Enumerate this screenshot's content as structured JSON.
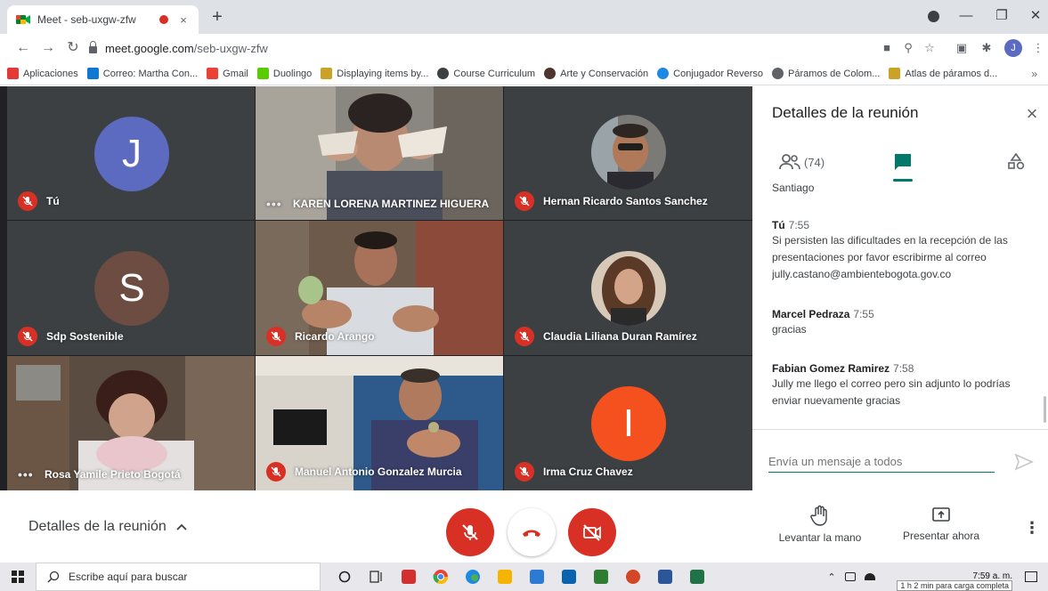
{
  "browser": {
    "tab_title": "Meet - seb-uxgw-zfw",
    "tab_close": "×",
    "new_tab": "+",
    "url_host": "meet.google.com",
    "url_path": "/seb-uxgw-zfw",
    "profile_initial": "J"
  },
  "bookmarks": [
    {
      "label": "Aplicaciones",
      "color": "#e53935"
    },
    {
      "label": "Correo: Martha Con...",
      "color": "#0f78d4"
    },
    {
      "label": "Gmail",
      "color": "#ea4335"
    },
    {
      "label": "Duolingo",
      "color": "#58cc02"
    },
    {
      "label": "Displaying items by...",
      "color": "#c9a227"
    },
    {
      "label": "Course Curriculum",
      "color": "#3c4043"
    },
    {
      "label": "Arte y Conservación",
      "color": "#4e342e"
    },
    {
      "label": "Conjugador Reverso",
      "color": "#1e88e5"
    },
    {
      "label": "Páramos de Colom...",
      "color": "#5f6368"
    },
    {
      "label": "Atlas de páramos d...",
      "color": "#c9a227"
    }
  ],
  "bookmarks_more": "»",
  "participants": [
    {
      "name": "Tú",
      "status": "muted"
    },
    {
      "name": "KAREN LORENA MARTINEZ HIGUERA",
      "status": "speaking"
    },
    {
      "name": "Hernan Ricardo Santos Sanchez",
      "status": "muted"
    },
    {
      "name": "Sdp Sostenible",
      "status": "muted"
    },
    {
      "name": "Ricardo Arango",
      "status": "muted"
    },
    {
      "name": "Claudia Liliana Duran Ramírez",
      "status": "muted"
    },
    {
      "name": "Rosa Yamile Prieto Bogotá",
      "status": "speaking"
    },
    {
      "name": "Manuel Antonio Gonzalez Murcia",
      "status": "muted"
    },
    {
      "name": "Irma Cruz Chavez",
      "status": "muted"
    }
  ],
  "avatars": {
    "tu": {
      "letter": "J",
      "color": "#5c6bc0"
    },
    "sdp": {
      "letter": "S",
      "color": "#6d4c41"
    },
    "irma": {
      "letter": "I",
      "color": "#f4511e"
    }
  },
  "panel": {
    "title": "Detalles de la reunión",
    "close": "×",
    "people_count": "(74)",
    "accent": "#00796b",
    "truncated_top": "Santiago",
    "messages": [
      {
        "sender": "Tú",
        "time": "7:55",
        "text": "Si persisten las dificultades en la recepción de las presentaciones por favor escribirme al correo jully.castano@ambientebogota.gov.co"
      },
      {
        "sender": "Marcel Pedraza",
        "time": "7:55",
        "text": "gracias"
      },
      {
        "sender": "Fabian Gomez Ramirez",
        "time": "7:58",
        "text": "Jully me llego el correo pero sin adjunto lo podrías enviar nuevamente gracias"
      }
    ],
    "input_placeholder": "Envía un mensaje a todos"
  },
  "callbar": {
    "details_label": "Detalles de la reunión",
    "raise_hand": "Levantar la mano",
    "present_now": "Presentar ahora"
  },
  "taskbar": {
    "search_placeholder": "Escribe aquí para buscar",
    "time": "7:59 a. m.",
    "battery_tooltip": "1 h 2 min para carga completa"
  }
}
